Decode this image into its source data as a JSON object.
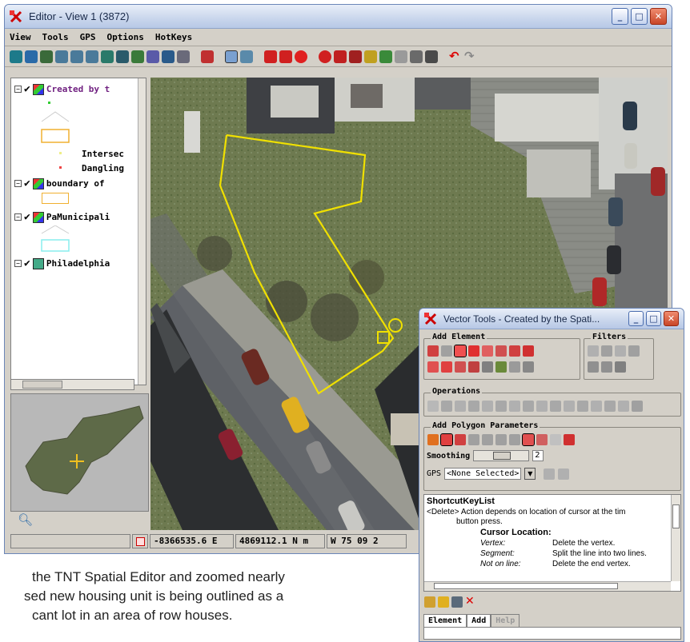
{
  "editor": {
    "title": "Editor - View 1 (3872)",
    "menu": [
      "View",
      "Tools",
      "GPS",
      "Options",
      "HotKeys"
    ],
    "legend_layers": [
      {
        "label": "Created by t",
        "expander": "⊟",
        "checked": true
      },
      {
        "label": "Intersec"
      },
      {
        "label": "Dangling"
      },
      {
        "label": "boundary of",
        "expander": "⊟",
        "checked": true
      },
      {
        "label": "PaMunicipali",
        "expander": "⊟",
        "checked": true
      },
      {
        "label": "Philadelphia",
        "expander": "⊟",
        "checked": true
      }
    ],
    "status": {
      "easting": "-8366535.6 E",
      "northing": "4869112.1 N m",
      "longitude": "W 75 09 2"
    }
  },
  "vector_tools": {
    "title": "Vector Tools - Created by the Spati...",
    "add_element_label": "Add Element",
    "filters_label": "Filters",
    "operations_label": "Operations",
    "polygon_params_label": "Add Polygon Parameters",
    "smoothing_label": "Smoothing",
    "smoothing_value": "2",
    "gps_label": "GPS",
    "gps_value": "<None Selected>",
    "shortcut_header": "ShortcutKeyList",
    "shortcut_delete_key": "<Delete>",
    "shortcut_delete_desc": "Action depends on location of cursor at the tim",
    "shortcut_delete_desc2": "button press.",
    "cursor_location": "Cursor Location:",
    "rows": [
      {
        "where": "Vertex:",
        "action": "Delete the vertex."
      },
      {
        "where": "Segment:",
        "action": "Split the line into two lines."
      },
      {
        "where": "Not on line:",
        "action": "Delete the end vertex."
      }
    ],
    "tabs": [
      "Element",
      "Add",
      "Help"
    ]
  },
  "caption": {
    "line1": "the TNT Spatial Editor and zoomed nearly",
    "line2": "sed new housing unit is being outlined as a",
    "line3": "cant lot in an area of row houses."
  },
  "colors": {
    "outline_yellow": "#f0e000",
    "title_blue": "#c9d6ec"
  }
}
